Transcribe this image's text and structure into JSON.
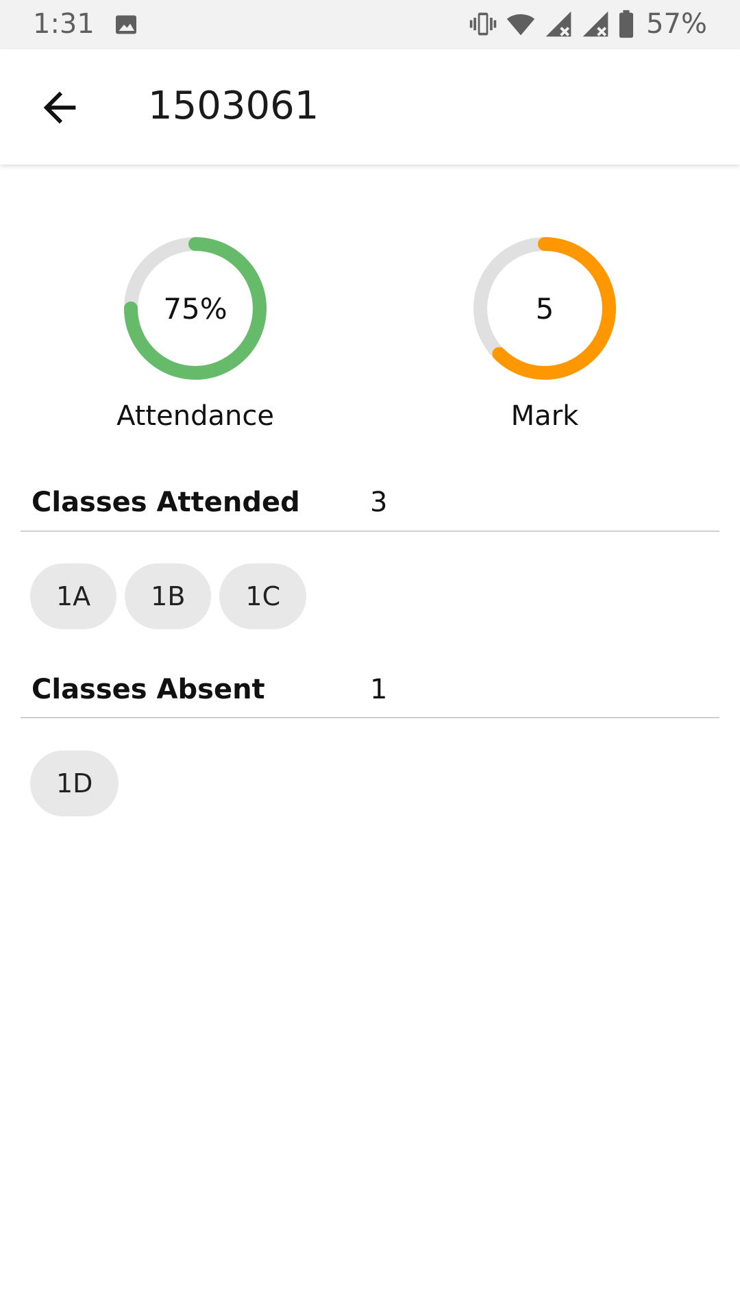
{
  "status_bar": {
    "time": "1:31",
    "battery": "57%",
    "icons": [
      "image-icon",
      "vibrate-icon",
      "wifi-icon",
      "signal-no-data-icon",
      "signal-no-data-icon",
      "battery-icon"
    ]
  },
  "app_bar": {
    "title": "1503061",
    "back_icon": "arrow-left-icon"
  },
  "stats": {
    "attendance": {
      "value": "75%",
      "label": "Attendance",
      "progress": 0.75,
      "color": "#66bb6a",
      "track": "#e0e0e0"
    },
    "mark": {
      "value": "5",
      "label": "Mark",
      "progress": 0.625,
      "color": "#ff9800",
      "track": "#e0e0e0"
    }
  },
  "classes_attended": {
    "label": "Classes Attended",
    "count": "3",
    "items": [
      "1A",
      "1B",
      "1C"
    ]
  },
  "classes_absent": {
    "label": "Classes Absent",
    "count": "1",
    "items": [
      "1D"
    ]
  }
}
